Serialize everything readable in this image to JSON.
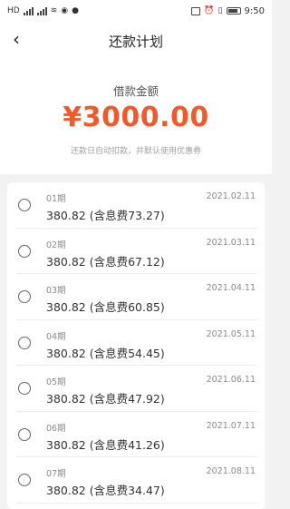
{
  "status_bar": {
    "left_icons": [
      "HD",
      "5G",
      "4G",
      "wifi-icon",
      "weibo-icon",
      "chat-icon"
    ],
    "time": "9:50"
  },
  "nav": {
    "back_icon": "chevron-left-icon",
    "title": "还款计划"
  },
  "summary": {
    "label": "借款金额",
    "amount": "¥3000.00",
    "note": "还款日自动扣款，并默认使用优惠券"
  },
  "plan": [
    {
      "period": "01期",
      "date": "2021.02.11",
      "amount": "380.82 (含息费73.27)"
    },
    {
      "period": "02期",
      "date": "2021.03.11",
      "amount": "380.82 (含息费67.12)"
    },
    {
      "period": "03期",
      "date": "2021.04.11",
      "amount": "380.82 (含息费60.85)"
    },
    {
      "period": "04期",
      "date": "2021.05.11",
      "amount": "380.82 (含息费54.45)"
    },
    {
      "period": "05期",
      "date": "2021.06.11",
      "amount": "380.82 (含息费47.92)"
    },
    {
      "period": "06期",
      "date": "2021.07.11",
      "amount": "380.82 (含息费41.26)"
    },
    {
      "period": "07期",
      "date": "2021.08.11",
      "amount": "380.82 (含息费34.47)"
    }
  ],
  "colors": {
    "accent": "#f05a2a",
    "background": "#f2f2f2"
  }
}
